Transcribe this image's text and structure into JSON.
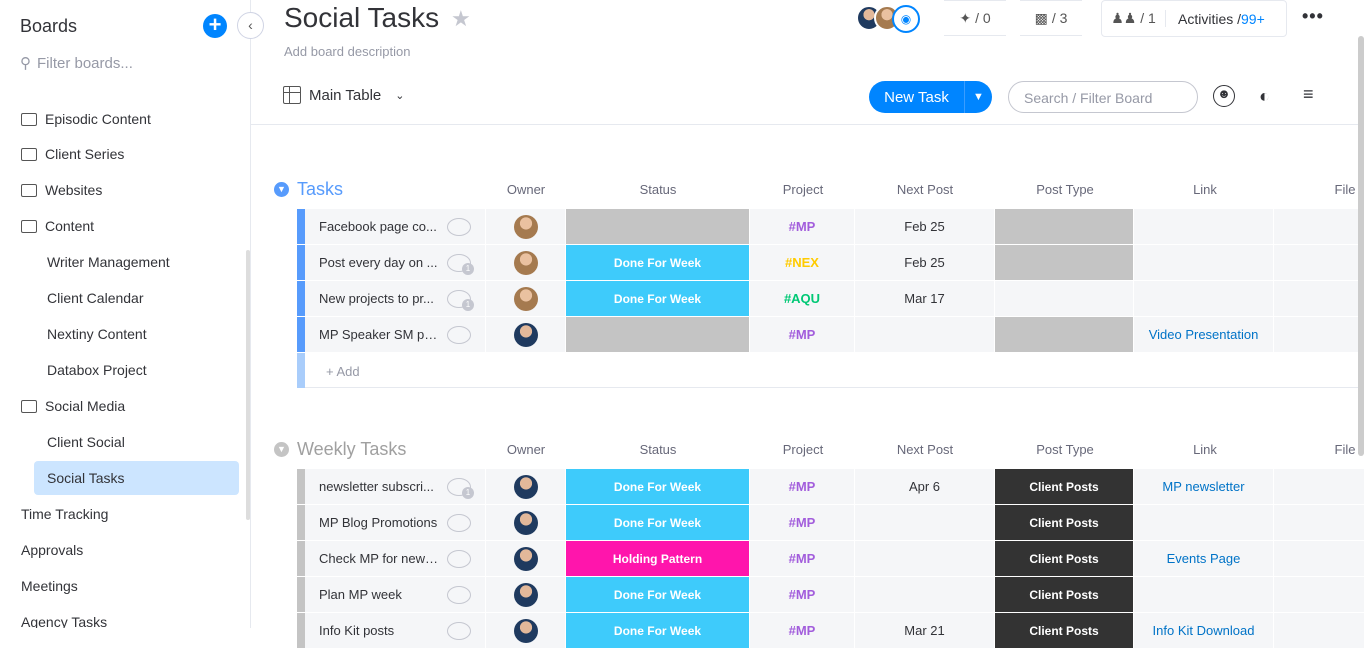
{
  "sidebar": {
    "title": "Boards",
    "filter_placeholder": "Filter boards...",
    "items": [
      {
        "label": "Episodic Content",
        "type": "folder"
      },
      {
        "label": "Client Series",
        "type": "folder"
      },
      {
        "label": "Websites",
        "type": "folder"
      },
      {
        "label": "Content",
        "type": "folder-open"
      },
      {
        "label": "Writer Management",
        "type": "board"
      },
      {
        "label": "Client Calendar",
        "type": "board"
      },
      {
        "label": "Nextiny Content",
        "type": "board"
      },
      {
        "label": "Databox Project",
        "type": "board"
      },
      {
        "label": "Social Media",
        "type": "folder-open"
      },
      {
        "label": "Client Social",
        "type": "board"
      },
      {
        "label": "Social Tasks",
        "type": "board",
        "active": true
      },
      {
        "label": "Time Tracking",
        "type": "top"
      },
      {
        "label": "Approvals",
        "type": "top"
      },
      {
        "label": "Meetings",
        "type": "top"
      },
      {
        "label": "Agency Tasks",
        "type": "top"
      }
    ]
  },
  "header": {
    "title": "Social Tasks",
    "description": "Add board description",
    "integrations": "/ 0",
    "automations": "/ 3",
    "members": "/ 1",
    "activities_label": "Activities /",
    "activities_count": "99+",
    "view": "Main Table",
    "new_task": "New Task",
    "search_placeholder": "Search / Filter Board"
  },
  "columns": [
    "Owner",
    "Status",
    "Project",
    "Next Post",
    "Post Type",
    "Link",
    "File"
  ],
  "colors": {
    "accent": "#0085ff",
    "done": "#3ecbfb",
    "holding": "#ff15ac",
    "grey": "#c4c4c4",
    "client_posts": "#333333",
    "mp": "#a25ddc",
    "nex": "#ffcb00",
    "aqu": "#00c875"
  },
  "groups": [
    {
      "title": "Tasks",
      "color": "#579bfc",
      "add_label": "+ Add",
      "rows": [
        {
          "name": "Facebook page co...",
          "updates": false,
          "status": "",
          "status_color": "#c4c4c4",
          "project": "#MP",
          "project_color": "#a25ddc",
          "next_post": "Feb 25",
          "post_type": "",
          "post_type_color": "#c4c4c4",
          "link": ""
        },
        {
          "name": "Post every day on ...",
          "updates": true,
          "status": "Done For Week",
          "status_color": "#3ecbfb",
          "project": "#NEX",
          "project_color": "#ffcb00",
          "next_post": "Feb 25",
          "post_type": "",
          "post_type_color": "#c4c4c4",
          "link": ""
        },
        {
          "name": "New projects to pr...",
          "updates": true,
          "status": "Done For Week",
          "status_color": "#3ecbfb",
          "project": "#AQU",
          "project_color": "#00c875",
          "next_post": "Mar 17",
          "post_type": "",
          "post_type_color": "#f5f6f8",
          "link": ""
        },
        {
          "name": "MP Speaker SM po...",
          "updates": false,
          "status": "",
          "status_color": "#c4c4c4",
          "project": "#MP",
          "project_color": "#a25ddc",
          "next_post": "",
          "post_type": "",
          "post_type_color": "#c4c4c4",
          "link": "Video Presentation"
        }
      ]
    },
    {
      "title": "Weekly Tasks",
      "color": "#c4c4c4",
      "rows": [
        {
          "name": "newsletter subscri...",
          "updates": true,
          "status": "Done For Week",
          "status_color": "#3ecbfb",
          "project": "#MP",
          "project_color": "#a25ddc",
          "next_post": "Apr 6",
          "post_type": "Client Posts",
          "post_type_color": "#333333",
          "link": "MP newsletter"
        },
        {
          "name": "MP Blog Promotions",
          "updates": false,
          "status": "Done For Week",
          "status_color": "#3ecbfb",
          "project": "#MP",
          "project_color": "#a25ddc",
          "next_post": "",
          "post_type": "Client Posts",
          "post_type_color": "#333333",
          "link": ""
        },
        {
          "name": "Check MP for new ...",
          "updates": false,
          "status": "Holding Pattern",
          "status_color": "#ff15ac",
          "project": "#MP",
          "project_color": "#a25ddc",
          "next_post": "",
          "post_type": "Client Posts",
          "post_type_color": "#333333",
          "link": "Events Page"
        },
        {
          "name": "Plan MP week",
          "updates": false,
          "status": "Done For Week",
          "status_color": "#3ecbfb",
          "project": "#MP",
          "project_color": "#a25ddc",
          "next_post": "",
          "post_type": "Client Posts",
          "post_type_color": "#333333",
          "link": ""
        },
        {
          "name": "Info Kit posts",
          "updates": false,
          "status": "Done For Week",
          "status_color": "#3ecbfb",
          "project": "#MP",
          "project_color": "#a25ddc",
          "next_post": "Mar 21",
          "post_type": "Client Posts",
          "post_type_color": "#333333",
          "link": "Info Kit Download"
        }
      ]
    }
  ]
}
